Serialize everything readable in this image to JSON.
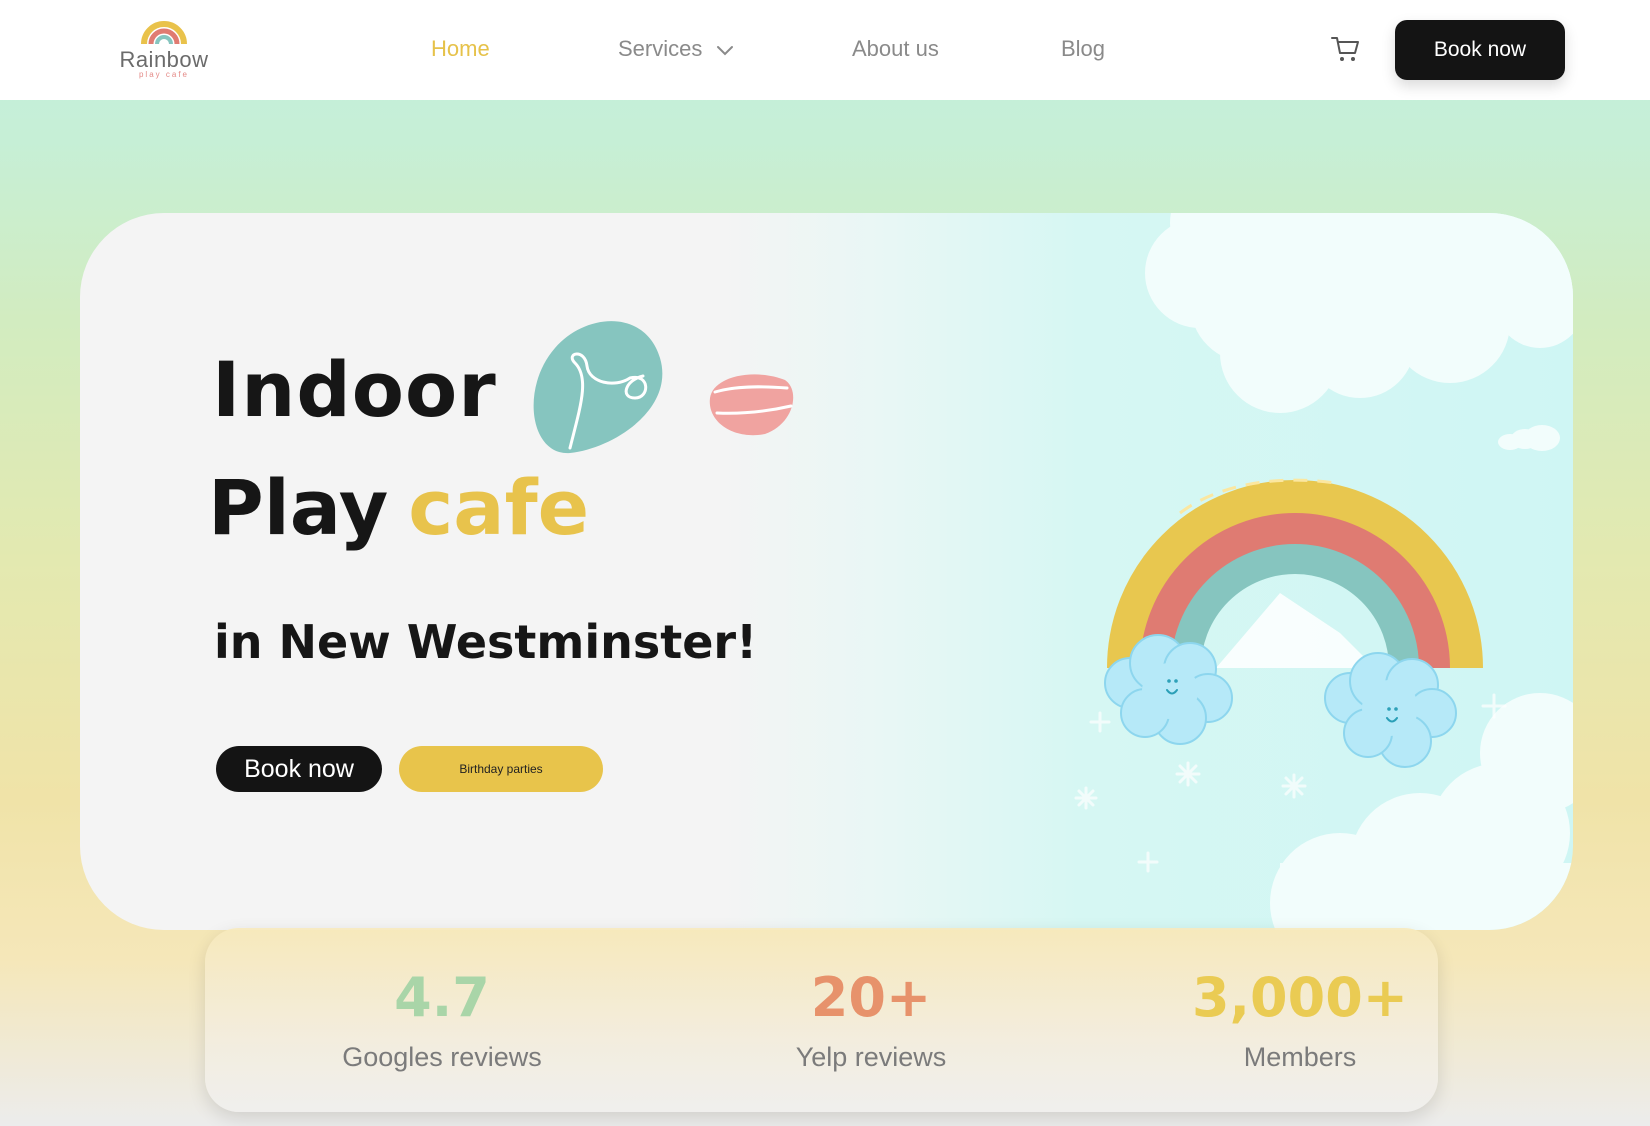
{
  "brand": {
    "name": "Rainbow",
    "tagline": "play cafe"
  },
  "nav": {
    "items": [
      {
        "label": "Home",
        "active": true
      },
      {
        "label": "Services",
        "has_dropdown": true
      },
      {
        "label": "About us"
      },
      {
        "label": "Blog"
      }
    ],
    "cart_icon": "cart-icon",
    "cta_label": "Book now"
  },
  "hero": {
    "title_line1": "Indoor",
    "title_line2_a": "Play",
    "title_line2_b": "cafe",
    "subtitle": "in New Westminster!",
    "primary_button": "Book now",
    "secondary_button": "Birthday parties"
  },
  "stats": [
    {
      "value": "4.7",
      "label": "Googles reviews",
      "color": "#a9d5a8"
    },
    {
      "value": "20+",
      "label": "Yelp reviews",
      "color": "#e7926b"
    },
    {
      "value": "3,000+",
      "label": "Members",
      "color": "#eacb53"
    }
  ],
  "colors": {
    "accent_yellow": "#e8c34c",
    "dark": "#141414",
    "teal": "#86c5bf",
    "pink": "#f0a3a0"
  }
}
